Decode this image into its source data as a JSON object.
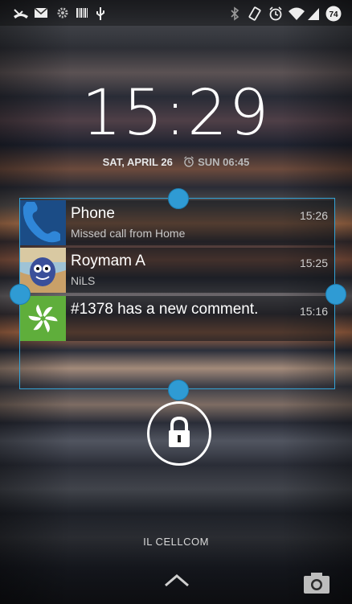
{
  "status_bar": {
    "icons": [
      "missed-call-icon",
      "gmail-icon",
      "settings-icon",
      "barcode-icon",
      "usb-icon",
      "bluetooth-icon",
      "rotate-icon",
      "alarm-icon",
      "wifi-icon",
      "signal-icon",
      "battery-icon"
    ],
    "battery_level": "74"
  },
  "clock": {
    "time": "15:29",
    "date": "SAT, APRIL 26",
    "alarm": "SUN 06:45"
  },
  "notifications": [
    {
      "icon": "phone-icon",
      "title": "Phone",
      "subtitle": "Missed call from Home",
      "time": "15:26"
    },
    {
      "icon": "contact-avatar-icon",
      "title": "Roymam A",
      "subtitle": "NiLS",
      "time": "15:25"
    },
    {
      "icon": "app-logo-icon",
      "title": "#1378 has a new comment.",
      "subtitle": "",
      "time": "15:16"
    }
  ],
  "carrier": "IL CELLCOM",
  "colors": {
    "accent": "#33a3d6",
    "app_green": "#5fae3b"
  }
}
